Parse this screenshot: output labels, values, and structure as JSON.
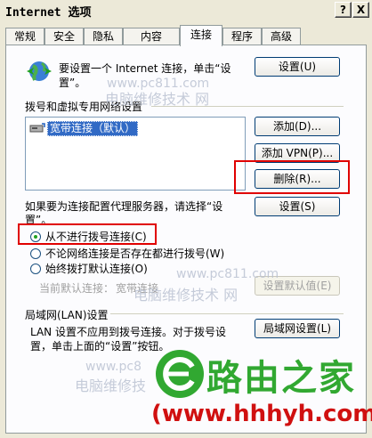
{
  "window": {
    "title": "Internet 选项",
    "help_label": "?",
    "close_label": "X"
  },
  "tabs": [
    {
      "label": "常规"
    },
    {
      "label": "安全"
    },
    {
      "label": "隐私"
    },
    {
      "label": "内容"
    },
    {
      "label": "连接",
      "active": true
    },
    {
      "label": "程序"
    },
    {
      "label": "高级"
    }
  ],
  "setup": {
    "text_line1": "要设置一个 Internet 连接，单击“设",
    "text_line2": "置”。",
    "button": "设置(U)"
  },
  "dialup": {
    "heading": "拨号和虚拟专用网络设置",
    "items": [
      {
        "label": "宽带连接（默认）",
        "selected": true
      }
    ],
    "add_button": "添加(D)...",
    "add_vpn_button": "添加 VPN(P)...",
    "delete_button": "删除(R)...",
    "proxy_line1": "如果要为连接配置代理服务器，请选择“设",
    "proxy_line2": "置”。",
    "settings_button": "设置(S)",
    "options": [
      {
        "label": "从不进行拨号连接(C)",
        "checked": true
      },
      {
        "label": "不论网络连接是否存在都进行拨号(W)",
        "checked": false
      },
      {
        "label": "始终拨打默认连接(O)",
        "checked": false
      }
    ],
    "current_default_label": "当前默认连接：",
    "current_default_value": "宽带连接",
    "set_default_button": "设置默认值(E)"
  },
  "lan": {
    "heading": "局域网(LAN)设置",
    "text_line1": "LAN 设置不应用到拨号连接。对于拨号设",
    "text_line2": "置，单击上面的“设置”按钮。",
    "button": "局域网设置(L)"
  },
  "watermarks": {
    "site1": "www.pc811.com",
    "caption1": "电脑维修技术 网",
    "site2": "www.pc811.com",
    "caption2": "电脑维修技术 网",
    "site3": "www.pc8",
    "caption3": "电脑维修技",
    "brand_name": "路由之家",
    "brand_url": "(www.hhhyh.com)"
  },
  "colors": {
    "highlight_red": "#e00000",
    "brand_green": "#31a831",
    "brand_red": "#d01010",
    "selection_blue": "#316ac5"
  }
}
